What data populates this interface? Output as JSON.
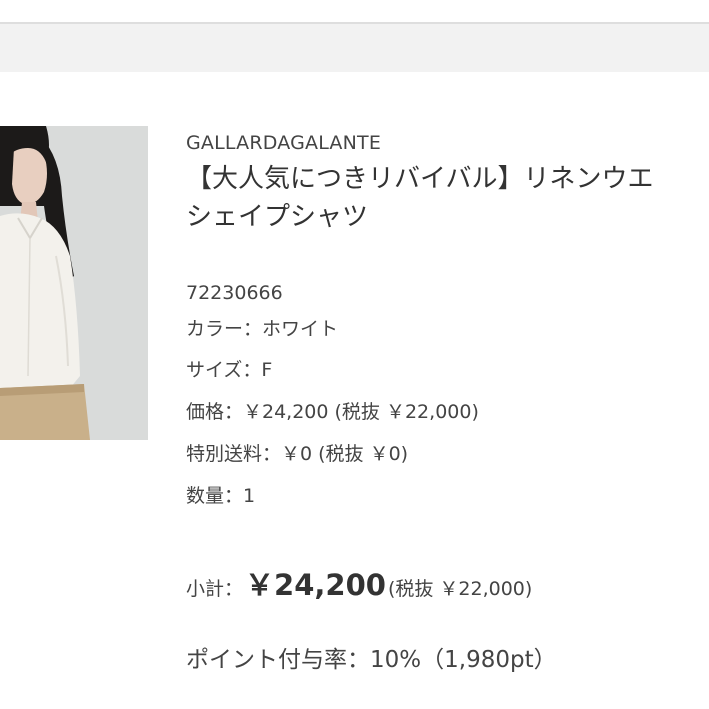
{
  "product": {
    "brand": "GALLARDAGALANTE",
    "title_line1": "【大人気につきリバイバル】リネンウエ",
    "title_line2": "シェイプシャツ",
    "code": "72230666",
    "color": "カラー：ホワイト",
    "size": "サイズ：F",
    "price": "価格：￥24,200 (税抜 ￥22,000)",
    "shipping": "特別送料：￥0 (税抜 ￥0)",
    "quantity": "数量：1"
  },
  "summary": {
    "subtotal_label": "小計：",
    "subtotal_amount": "￥24,200",
    "subtotal_tax": "(税抜 ￥22,000)",
    "points": "ポイント付与率：10%（1,980pt）"
  },
  "colors": {
    "bar_background": "#f2f2f2",
    "text": "#333333"
  }
}
